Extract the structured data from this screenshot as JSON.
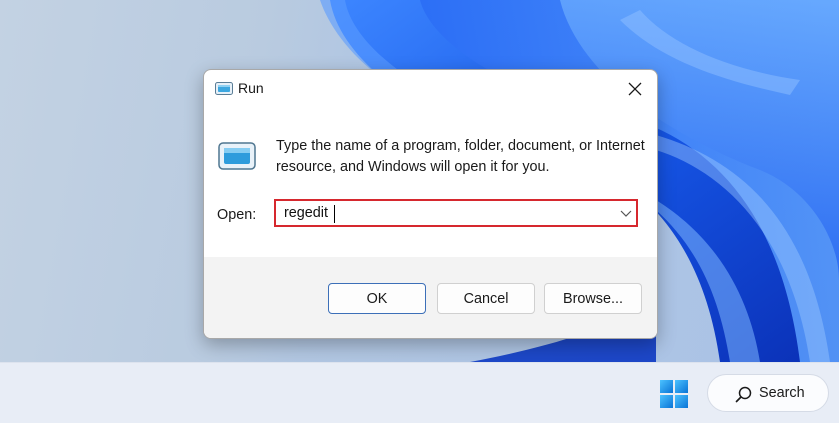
{
  "dialog": {
    "title": "Run",
    "description": "Type the name of a program, folder, document, or Internet resource, and Windows will open it for you.",
    "open_label": "Open:",
    "open_value": "regedit",
    "buttons": {
      "ok": "OK",
      "cancel": "Cancel",
      "browse": "Browse..."
    }
  },
  "taskbar": {
    "search_label": "Search"
  },
  "colors": {
    "highlight_border": "#d6282e",
    "ok_border": "#3c6fb8",
    "wallpaper_blue": "#1a5fe8"
  },
  "icons": {
    "title": "run-icon",
    "close": "close-icon",
    "dropdown": "chevron-down-icon",
    "start": "windows-start-icon",
    "search": "search-icon"
  }
}
